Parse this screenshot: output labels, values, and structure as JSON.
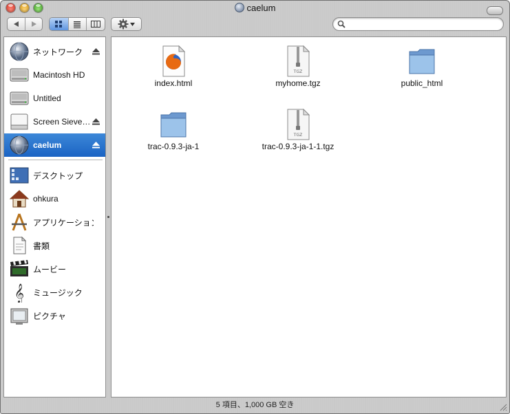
{
  "window": {
    "title": "caelum"
  },
  "toolbar": {
    "back_label": "◀",
    "forward_label": "▶",
    "view_modes": [
      "icon",
      "list",
      "column"
    ],
    "action_label": "⚙",
    "search": {
      "value": "",
      "placeholder": ""
    }
  },
  "sidebar": {
    "devices": [
      {
        "label": "ネットワーク",
        "icon": "network-globe-icon",
        "eject": true,
        "selected": false
      },
      {
        "label": "Macintosh HD",
        "icon": "hard-drive-icon",
        "eject": false,
        "selected": false
      },
      {
        "label": "Untitled",
        "icon": "hard-drive-icon",
        "eject": false,
        "selected": false
      },
      {
        "label": "Screen Sieve…",
        "icon": "disk-image-icon",
        "eject": true,
        "selected": false
      },
      {
        "label": "caelum",
        "icon": "network-globe-icon",
        "eject": true,
        "selected": true
      }
    ],
    "places": [
      {
        "label": "デスクトップ",
        "icon": "desktop-icon"
      },
      {
        "label": "ohkura",
        "icon": "home-icon"
      },
      {
        "label": "アプリケーション",
        "icon": "applications-icon"
      },
      {
        "label": "書類",
        "icon": "documents-icon"
      },
      {
        "label": "ムービー",
        "icon": "movies-icon"
      },
      {
        "label": "ミュージック",
        "icon": "music-icon"
      },
      {
        "label": "ピクチャ",
        "icon": "pictures-icon"
      }
    ]
  },
  "files": [
    {
      "name": "index.html",
      "icon": "firefox-html-icon"
    },
    {
      "name": "myhome.tgz",
      "icon": "tgz-archive-icon"
    },
    {
      "name": "public_html",
      "icon": "folder-icon"
    },
    {
      "name": "trac-0.9.3-ja-1",
      "icon": "folder-icon"
    },
    {
      "name": "trac-0.9.3-ja-1-1.tgz",
      "icon": "tgz-archive-icon"
    }
  ],
  "archive_badge": "TGZ",
  "status": "5 項目、1,000 GB 空き",
  "colors": {
    "selection": "#1b63c3",
    "folder": "#7aa6d8"
  }
}
